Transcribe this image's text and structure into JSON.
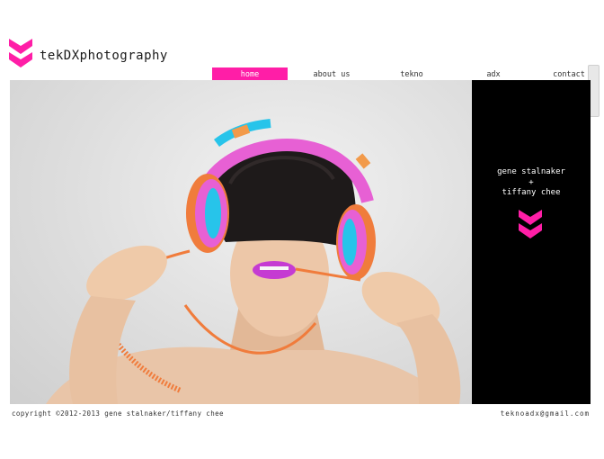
{
  "header": {
    "logo_text": "tekDXphotography"
  },
  "nav": {
    "items": [
      {
        "label": "home",
        "active": true
      },
      {
        "label": "about us",
        "active": false
      },
      {
        "label": "tekno",
        "active": false
      },
      {
        "label": "adx",
        "active": false
      },
      {
        "label": "contact",
        "active": false
      }
    ]
  },
  "side_panel": {
    "line1": "gene stalnaker",
    "line2": "+",
    "line3": "tiffany chee"
  },
  "footer": {
    "copyright": "copyright ©2012-2013 gene stalnaker/tiffany chee",
    "email": "teknoadx@gmail.com"
  },
  "colors": {
    "accent": "#ff1ea7",
    "panel": "#000000"
  },
  "icons": {
    "logo": "double-chevron-down-icon",
    "scroll": "double-chevron-down-icon"
  }
}
